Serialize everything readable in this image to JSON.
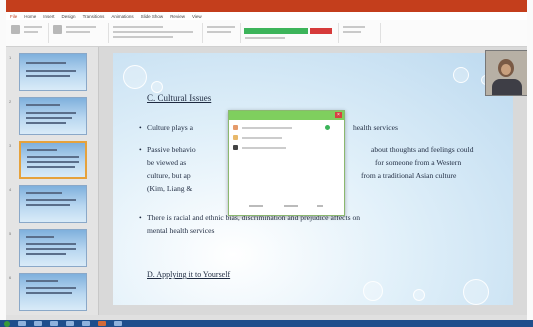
{
  "window": {
    "title": ""
  },
  "ribbon": {
    "tabs": [
      "File",
      "Home",
      "Insert",
      "Design",
      "Transitions",
      "Animations",
      "Slide Show",
      "Review",
      "View"
    ]
  },
  "thumbnails": [
    {
      "number": "1"
    },
    {
      "number": "2"
    },
    {
      "number": "3"
    },
    {
      "number": "4"
    },
    {
      "number": "5"
    },
    {
      "number": "6"
    }
  ],
  "slide": {
    "heading": "C. Cultural Issues",
    "bullet1": "Culture plays a",
    "bullet1_tail": "health services",
    "bullet2_line1_a": "Passive behavio",
    "bullet2_line1_b": "about thoughts and feelings could",
    "bullet2_line2_a": "be viewed as",
    "bullet2_line2_b": "for someone from a Western",
    "bullet2_line3_a": "culture, but ap",
    "bullet2_line3_b": "from a traditional Asian culture",
    "bullet2_line4": "(Kim, Liang &",
    "bullet3_line1": "There is racial and ethnic bias, discrimination and prejudice affects on",
    "bullet3_line2": "mental health services",
    "footer": "D. Applying it to Yourself"
  },
  "colors": {
    "accent": "#c43e1c",
    "dialog_title": "#7fcf5e",
    "slide_bg": "#bcd9ef"
  }
}
